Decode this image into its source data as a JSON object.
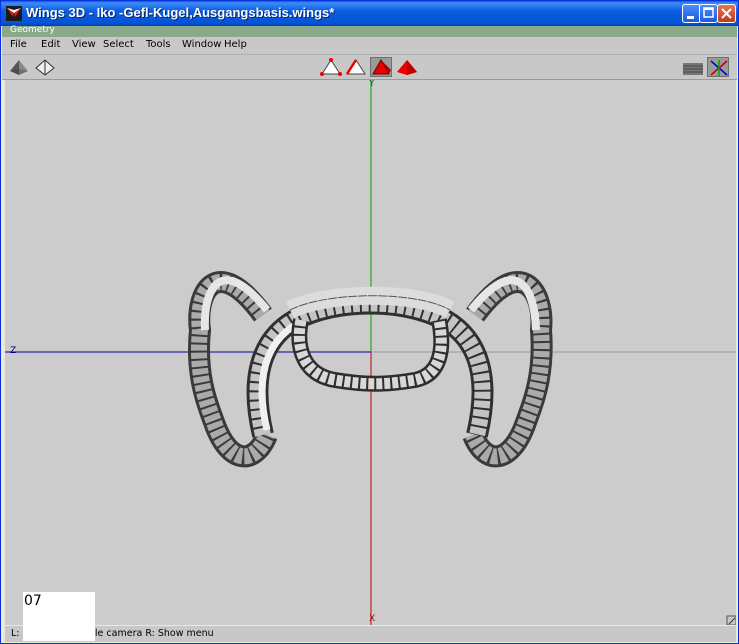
{
  "window": {
    "title": "Wings 3D - Iko -Gefl-Kugel,Ausgangsbasis.wings*"
  },
  "mode_bar": {
    "label": "Geometry"
  },
  "menu": {
    "items": [
      "File",
      "Edit",
      "View",
      "Select",
      "Tools",
      "Window",
      "Help"
    ]
  },
  "toolbar": {
    "left_tools": [
      "smooth-shaded-icon",
      "wireframe-icon"
    ],
    "selection_modes": [
      "vertex-mode-icon",
      "edge-mode-icon",
      "face-mode-icon",
      "body-mode-icon"
    ],
    "active_mode": "face-mode-icon",
    "right_tools": [
      "ground-grid-icon",
      "show-axes-icon"
    ]
  },
  "viewport": {
    "axis_labels": {
      "y": "Y",
      "z": "Z",
      "x": "X"
    },
    "colors": {
      "background": "#cccccc",
      "y_axis": "#00a000",
      "z_axis": "#0000a0",
      "x_axis": "#c00000"
    }
  },
  "status": {
    "text": "L: Select   M: Tumble camera   R: Show menu",
    "frame_counter": "07"
  }
}
